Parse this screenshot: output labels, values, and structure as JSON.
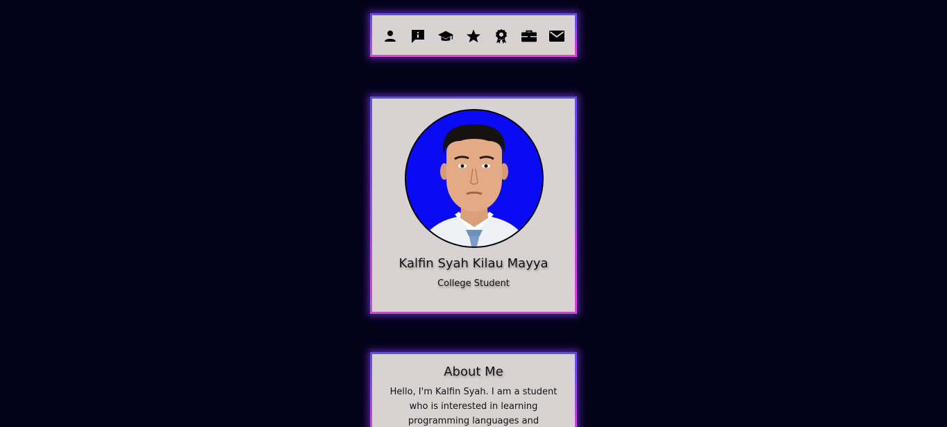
{
  "nav": {
    "icons": [
      "person-icon",
      "info-message-icon",
      "graduation-cap-icon",
      "star-icon",
      "award-ribbon-icon",
      "briefcase-icon",
      "mail-icon"
    ]
  },
  "profile": {
    "name": "Kalfin Syah Kilau Mayya",
    "role": "College Student",
    "photo_background": "#0a0af5"
  },
  "about": {
    "title": "About Me",
    "text": "Hello, I'm Kalfin Syah. I am a student who is interested in learning programming languages and bodyweight exercises."
  },
  "colors": {
    "page_background": "#04021a",
    "card_background": "#d9d2d2",
    "border_gradient_top": "#5a4cf2",
    "border_gradient_bottom": "#e23fd3"
  }
}
